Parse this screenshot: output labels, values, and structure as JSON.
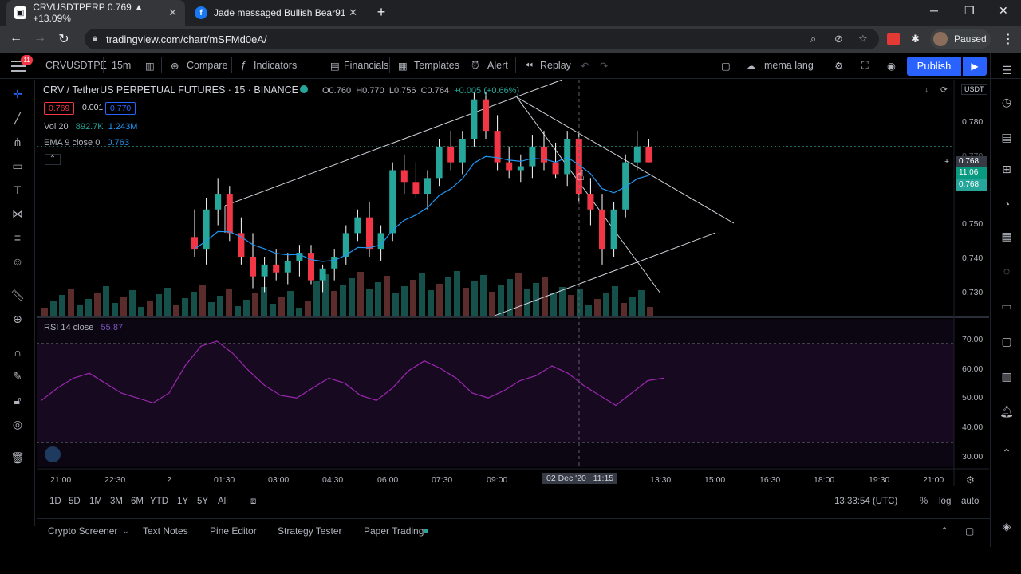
{
  "browser": {
    "tabs": [
      {
        "title": "CRVUSDTPERP 0.769 ▲ +13.09%",
        "favicon": "tradingview-icon"
      },
      {
        "title": "Jade messaged Bullish Bear91",
        "favicon": "facebook-icon"
      }
    ],
    "url": "tradingview.com/chart/mSFMd0eA/",
    "profile_label": "Paused"
  },
  "toolbar": {
    "notification_count": "11",
    "symbol": "CRVUSDTPE",
    "interval": "15m",
    "compare": "Compare",
    "indicators": "Indicators",
    "financials": "Financials",
    "templates": "Templates",
    "alert": "Alert",
    "replay": "Replay",
    "layout_name": "mema lang",
    "publish": "Publish"
  },
  "legend": {
    "title": "CRV / TetherUS PERPETUAL FUTURES · 15 · BINANCE",
    "open": "O0.760",
    "high": "H0.770",
    "low": "L0.756",
    "close": "C0.764",
    "change": "+0.005 (+0.66%)",
    "bid": "0.769",
    "spread": "0.001",
    "ask": "0.770",
    "vol_label": "Vol 20",
    "vol_value": "892.7K",
    "vol_ma": "1.243M",
    "ema_label": "EMA 9 close 0",
    "ema_value": "0.763",
    "rsi_label": "RSI 14 close",
    "rsi_value": "55.87",
    "currency": "USDT"
  },
  "price_axis": [
    "0.780",
    "0.770",
    "0.750",
    "0.740",
    "0.730"
  ],
  "price_tags": {
    "cross": "0.768",
    "countdown": "11:06",
    "last": "0.768"
  },
  "rsi_axis": [
    "70.00",
    "60.00",
    "50.00",
    "40.00",
    "30.00"
  ],
  "time_axis": [
    "21:00",
    "22:30",
    "2",
    "01:30",
    "03:00",
    "04:30",
    "06:00",
    "07:30",
    "09:00",
    "13:30",
    "15:00",
    "16:30",
    "18:00",
    "19:30",
    "21:00"
  ],
  "crosshair_time": "02 Dec '20   11:15",
  "timeframes": [
    "1D",
    "5D",
    "1M",
    "3M",
    "6M",
    "YTD",
    "1Y",
    "5Y",
    "All"
  ],
  "clock": "13:33:54 (UTC)",
  "scale_opts": [
    "%",
    "log",
    "auto"
  ],
  "bottom_tabs": [
    "Crypto Screener",
    "Text Notes",
    "Pine Editor",
    "Strategy Tester",
    "Paper Trading"
  ],
  "colors": {
    "up": "#26a69a",
    "down": "#f23645",
    "accent": "#2962ff",
    "rsi": "#9c27b0",
    "ema": "#2196f3"
  },
  "chart_data": {
    "type": "candlestick",
    "symbol": "CRVUSDTPERP",
    "interval": "15",
    "ylim": [
      0.725,
      0.785
    ],
    "rsi_ylim": [
      30,
      70
    ],
    "candles": [
      [
        0.745,
        0.752,
        0.74,
        0.742
      ],
      [
        0.742,
        0.755,
        0.738,
        0.752
      ],
      [
        0.752,
        0.76,
        0.748,
        0.756
      ],
      [
        0.756,
        0.758,
        0.744,
        0.746
      ],
      [
        0.746,
        0.75,
        0.738,
        0.74
      ],
      [
        0.74,
        0.746,
        0.732,
        0.735
      ],
      [
        0.735,
        0.74,
        0.731,
        0.738
      ],
      [
        0.738,
        0.742,
        0.734,
        0.736
      ],
      [
        0.736,
        0.741,
        0.733,
        0.739
      ],
      [
        0.739,
        0.743,
        0.735,
        0.741
      ],
      [
        0.741,
        0.743,
        0.733,
        0.734
      ],
      [
        0.734,
        0.738,
        0.731,
        0.737
      ],
      [
        0.737,
        0.742,
        0.734,
        0.74
      ],
      [
        0.74,
        0.748,
        0.738,
        0.746
      ],
      [
        0.746,
        0.752,
        0.744,
        0.75
      ],
      [
        0.75,
        0.754,
        0.74,
        0.742
      ],
      [
        0.742,
        0.748,
        0.739,
        0.746
      ],
      [
        0.746,
        0.764,
        0.744,
        0.762
      ],
      [
        0.762,
        0.766,
        0.756,
        0.759
      ],
      [
        0.759,
        0.764,
        0.755,
        0.756
      ],
      [
        0.756,
        0.762,
        0.752,
        0.76
      ],
      [
        0.76,
        0.77,
        0.758,
        0.768
      ],
      [
        0.768,
        0.772,
        0.762,
        0.764
      ],
      [
        0.764,
        0.772,
        0.761,
        0.77
      ],
      [
        0.77,
        0.782,
        0.768,
        0.78
      ],
      [
        0.78,
        0.782,
        0.77,
        0.772
      ],
      [
        0.772,
        0.776,
        0.762,
        0.764
      ],
      [
        0.764,
        0.768,
        0.76,
        0.762
      ],
      [
        0.762,
        0.766,
        0.759,
        0.763
      ],
      [
        0.763,
        0.771,
        0.76,
        0.768
      ],
      [
        0.768,
        0.772,
        0.762,
        0.764
      ],
      [
        0.764,
        0.769,
        0.76,
        0.761
      ],
      [
        0.761,
        0.772,
        0.758,
        0.77
      ],
      [
        0.77,
        0.772,
        0.754,
        0.756
      ],
      [
        0.756,
        0.76,
        0.748,
        0.752
      ],
      [
        0.752,
        0.756,
        0.738,
        0.742
      ],
      [
        0.742,
        0.754,
        0.74,
        0.752
      ],
      [
        0.752,
        0.766,
        0.75,
        0.764
      ],
      [
        0.764,
        0.772,
        0.762,
        0.768
      ],
      [
        0.768,
        0.77,
        0.764,
        0.764
      ]
    ],
    "rsi": [
      47,
      52,
      56,
      58,
      54,
      50,
      48,
      46,
      50,
      61,
      69,
      71,
      66,
      59,
      53,
      49,
      48,
      52,
      56,
      54,
      49,
      47,
      52,
      59,
      63,
      60,
      56,
      50,
      48,
      51,
      55,
      57,
      61,
      58,
      53,
      49,
      45,
      50,
      55,
      56
    ]
  }
}
